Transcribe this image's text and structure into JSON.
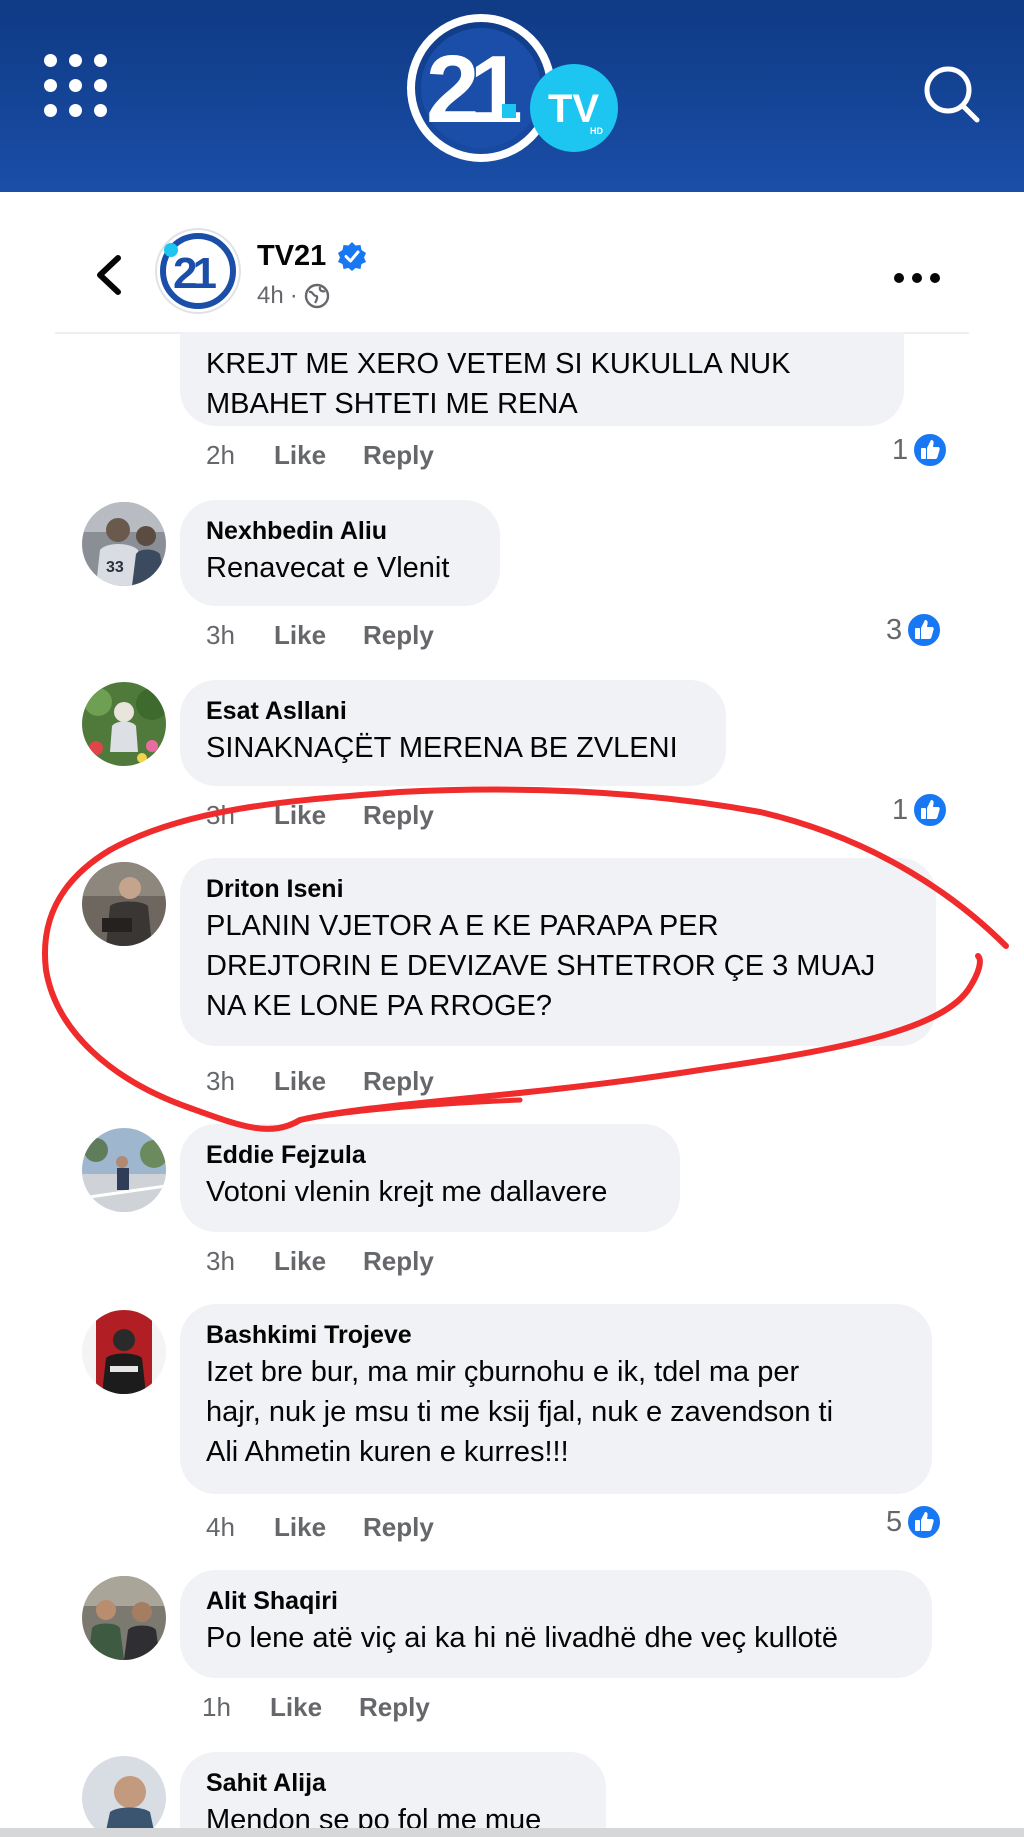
{
  "app": {
    "logo_text": "21",
    "logo_badge": "TV",
    "logo_badge_sub": "HD",
    "colors": {
      "header_bg": "#1a4ea8",
      "accent_cyan": "#1cc6f0",
      "like_blue": "#1877f2",
      "annotation_red": "#ef2b2b"
    }
  },
  "post": {
    "page_name": "TV21",
    "time": "4h",
    "separator": "·",
    "audience_icon": "globe-icon"
  },
  "comments": [
    {
      "name": "",
      "text": "KREJT ME XERO VETEM SI KUKULLA NUK\nMBAHET SHTETI ME RENA",
      "time": "2h",
      "like": "Like",
      "reply": "Reply",
      "reactions": "1"
    },
    {
      "name": "Nexhbedin Aliu",
      "text": "Renavecat e Vlenit",
      "time": "3h",
      "like": "Like",
      "reply": "Reply",
      "reactions": "3"
    },
    {
      "name": "Esat Asllani",
      "text": "SINAKNAÇËT MERENA BE ZVLENI",
      "time": "3h",
      "like": "Like",
      "reply": "Reply",
      "reactions": "1"
    },
    {
      "name": "Driton Iseni",
      "text": "PLANIN VJETOR A E KE PARAPA PER\nDREJTORIN E DEVIZAVE SHTETROR ÇE 3 MUAJ\nNA KE LONE PA RROGE?",
      "time": "3h",
      "like": "Like",
      "reply": "Reply",
      "reactions": ""
    },
    {
      "name": "Eddie Fejzula",
      "text": "Votoni vlenin krejt me dallavere",
      "time": "3h",
      "like": "Like",
      "reply": "Reply",
      "reactions": ""
    },
    {
      "name": "Bashkimi Trojeve",
      "text": "Izet bre bur, ma mir çburnohu e ik, tdel ma per\nhajr, nuk je msu ti me ksij fjal, nuk e zavendson ti\nAli Ahmetin kuren e kurres!!!",
      "time": "4h",
      "like": "Like",
      "reply": "Reply",
      "reactions": "5"
    },
    {
      "name": "Alit Shaqiri",
      "text": "Po lene atë viç ai ka hi në livadhë dhe veç kullotë",
      "time": "1h",
      "like": "Like",
      "reply": "Reply",
      "reactions": ""
    },
    {
      "name": "Sahit Alija",
      "text": "Mendon se po fol me mue",
      "time": "",
      "like": "",
      "reply": "",
      "reactions": ""
    }
  ]
}
